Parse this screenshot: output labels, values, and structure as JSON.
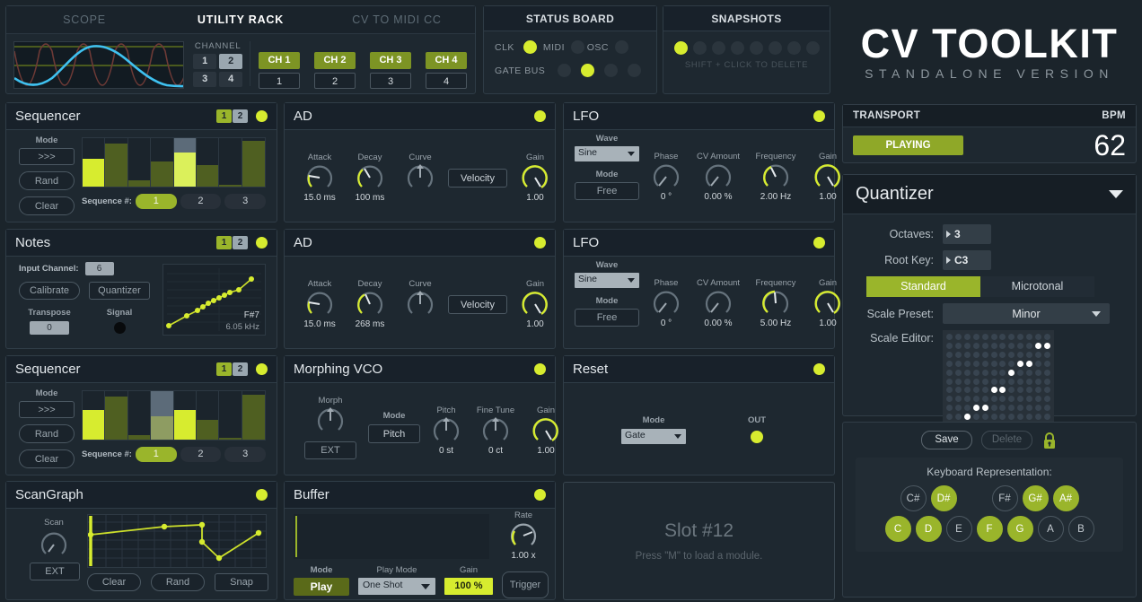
{
  "topbar": {
    "tabs": [
      {
        "label": "SCOPE",
        "active": false
      },
      {
        "label": "UTILITY RACK",
        "active": true
      },
      {
        "label": "CV TO MIDI CC",
        "active": false
      }
    ],
    "channel_label": "CHANNEL",
    "channel_buttons": [
      {
        "label": "1",
        "on": false
      },
      {
        "label": "2",
        "on": true
      },
      {
        "label": "3",
        "on": false
      },
      {
        "label": "4",
        "on": false
      }
    ],
    "utility_channels": [
      {
        "name": "CH 1",
        "value": "1"
      },
      {
        "name": "CH 2",
        "value": "2"
      },
      {
        "name": "CH 3",
        "value": "3"
      },
      {
        "name": "CH 4",
        "value": "4"
      }
    ]
  },
  "status_board": {
    "title": "STATUS BOARD",
    "row1": [
      {
        "label": "CLK",
        "on": true
      },
      {
        "label": "MIDI",
        "on": false
      },
      {
        "label": "OSC",
        "on": false
      }
    ],
    "gate_label": "GATE BUS",
    "gate_bus": [
      false,
      true,
      false,
      false
    ]
  },
  "snapshots": {
    "title": "SNAPSHOTS",
    "slots": [
      true,
      false,
      false,
      false,
      false,
      false,
      false,
      false
    ],
    "hint": "SHIFT + CLICK TO DELETE"
  },
  "brand": {
    "main": "CV TOOLKIT",
    "sub": "STANDALONE VERSION"
  },
  "transport": {
    "title": "TRANSPORT",
    "bpm_label": "BPM",
    "state": "PLAYING",
    "bpm": "62"
  },
  "quantizer": {
    "title": "Quantizer",
    "octaves_label": "Octaves:",
    "octaves_value": "3",
    "rootkey_label": "Root Key:",
    "rootkey_value": "C3",
    "mode_standard": "Standard",
    "mode_microtonal": "Microtonal",
    "mode_selected": "Standard",
    "scale_preset_label": "Scale Preset:",
    "scale_preset_value": "Minor",
    "scale_editor_label": "Scale Editor:",
    "scale_editor_on": [
      [
        1,
        10
      ],
      [
        1,
        11
      ],
      [
        3,
        8
      ],
      [
        3,
        9
      ],
      [
        4,
        7
      ],
      [
        6,
        5
      ],
      [
        6,
        6
      ],
      [
        8,
        3
      ],
      [
        8,
        4
      ],
      [
        9,
        2
      ],
      [
        11,
        0
      ],
      [
        11,
        1
      ]
    ],
    "save_label": "Save",
    "delete_label": "Delete",
    "lock_icon": "lock",
    "keyboard_title": "Keyboard Representation:",
    "black_keys": [
      {
        "label": "C#",
        "on": false
      },
      {
        "label": "D#",
        "on": true
      },
      {
        "label": "",
        "gap": true
      },
      {
        "label": "F#",
        "on": false
      },
      {
        "label": "G#",
        "on": true
      },
      {
        "label": "A#",
        "on": true
      }
    ],
    "white_keys": [
      {
        "label": "C",
        "on": true
      },
      {
        "label": "D",
        "on": true
      },
      {
        "label": "E",
        "on": false
      },
      {
        "label": "F",
        "on": true
      },
      {
        "label": "G",
        "on": true
      },
      {
        "label": "A",
        "on": false
      },
      {
        "label": "B",
        "on": false
      }
    ]
  },
  "modules": {
    "seq1": {
      "title": "Sequencer",
      "pp": [
        "1",
        "2"
      ],
      "mode_label": "Mode",
      "mode_value": ">>>",
      "rand_label": "Rand",
      "clear_label": "Clear",
      "sequence_label": "Sequence #:",
      "sequence_buttons": [
        {
          "label": "1",
          "on": true
        },
        {
          "label": "2",
          "on": false
        },
        {
          "label": "3",
          "on": false
        }
      ],
      "bars": [
        0.58,
        0.88,
        0.13,
        0.52,
        0.7,
        0.45,
        0.04,
        0.95
      ],
      "active_step": 4
    },
    "notes": {
      "title": "Notes",
      "pp": [
        "1",
        "2"
      ],
      "input_channel_label": "Input Channel:",
      "input_channel_value": "6",
      "calibrate_label": "Calibrate",
      "quantizer_label": "Quantizer",
      "transpose_label": "Transpose",
      "transpose_value": "0",
      "signal_label": "Signal",
      "note_value": "F#7",
      "freq_value": "6.05 kHz"
    },
    "seq2": {
      "title": "Sequencer",
      "pp": [
        "1",
        "2"
      ],
      "mode_label": "Mode",
      "mode_value": ">>>",
      "rand_label": "Rand",
      "clear_label": "Clear",
      "sequence_label": "Sequence #:",
      "sequence_buttons": [
        {
          "label": "1",
          "on": true
        },
        {
          "label": "2",
          "on": false
        },
        {
          "label": "3",
          "on": false
        }
      ],
      "bars": [
        0.62,
        0.88,
        0.1,
        0.48,
        0.62,
        0.4,
        0.03,
        0.92
      ],
      "active_step": 3
    },
    "scangraph": {
      "title": "ScanGraph",
      "scan_label": "Scan",
      "ext_label": "EXT",
      "clear_label": "Clear",
      "rand_label": "Rand",
      "snap_label": "Snap",
      "points": [
        [
          0,
          0.62
        ],
        [
          0.27,
          0.8
        ],
        [
          0.48,
          0.82
        ],
        [
          0.48,
          0.52
        ],
        [
          0.65,
          0.12
        ],
        [
          0.93,
          0.58
        ]
      ]
    },
    "ad1": {
      "title": "AD",
      "attack_label": "Attack",
      "attack_value": "15.0 ms",
      "attack_pos": 0.18,
      "decay_label": "Decay",
      "decay_value": "100 ms",
      "decay_pos": 0.35,
      "curve_label": "Curve",
      "curve_value": "",
      "curve_pos": 0.5,
      "velocity_label": "Velocity",
      "gain_label": "Gain",
      "gain_value": "1.00",
      "gain_pos": 0.82
    },
    "ad2": {
      "title": "AD",
      "attack_label": "Attack",
      "attack_value": "15.0 ms",
      "attack_pos": 0.18,
      "decay_label": "Decay",
      "decay_value": "268 ms",
      "decay_pos": 0.4,
      "curve_label": "Curve",
      "curve_value": "",
      "curve_pos": 0.5,
      "velocity_label": "Velocity",
      "gain_label": "Gain",
      "gain_value": "1.00",
      "gain_pos": 0.82
    },
    "vco": {
      "title": "Morphing VCO",
      "morph_label": "Morph",
      "morph_pos": 0.5,
      "ext_label": "EXT",
      "mode_label": "Mode",
      "mode_value": "Pitch",
      "pitch_label": "Pitch",
      "pitch_value": "0 st",
      "pitch_pos": 0.5,
      "finetune_label": "Fine Tune",
      "finetune_value": "0 ct",
      "finetune_pos": 0.5,
      "gain_label": "Gain",
      "gain_value": "1.00",
      "gain_pos": 0.82
    },
    "buffer": {
      "title": "Buffer",
      "rate_label": "Rate",
      "rate_value": "1.00 x",
      "rate_pos": 0.45,
      "mode_label": "Mode",
      "mode_value": "Play",
      "playmode_label": "Play Mode",
      "playmode_value": "One Shot",
      "gain_label": "Gain",
      "gain_value": "100 %",
      "trigger_label": "Trigger"
    },
    "lfo1": {
      "title": "LFO",
      "wave_label": "Wave",
      "wave_value": "Sine",
      "mode_label": "Mode",
      "mode_value": "Free",
      "phase_label": "Phase",
      "phase_value": "0 °",
      "phase_pos": 0.12,
      "cv_label": "CV Amount",
      "cv_value": "0.00 %",
      "cv_pos": 0.12,
      "freq_label": "Frequency",
      "freq_value": "2.00 Hz",
      "freq_pos": 0.4,
      "gain_label": "Gain",
      "gain_value": "1.00",
      "gain_pos": 0.82
    },
    "lfo2": {
      "title": "LFO",
      "wave_label": "Wave",
      "wave_value": "Sine",
      "mode_label": "Mode",
      "mode_value": "Free",
      "phase_label": "Phase",
      "phase_value": "0 °",
      "phase_pos": 0.12,
      "cv_label": "CV Amount",
      "cv_value": "0.00 %",
      "cv_pos": 0.12,
      "freq_label": "Frequency",
      "freq_value": "5.00 Hz",
      "freq_pos": 0.47,
      "gain_label": "Gain",
      "gain_value": "1.00",
      "gain_pos": 0.82
    },
    "reset": {
      "title": "Reset",
      "mode_label": "Mode",
      "mode_value": "Gate",
      "out_label": "OUT"
    },
    "slot": {
      "title": "Slot #12",
      "subtitle": "Press \"M\" to load a module."
    }
  },
  "colors": {
    "accent": "#d7ec2f",
    "green": "#9ab52b",
    "bg": "#1b242b",
    "panel": "#1e2830",
    "scope_line": "#3fc1f0"
  }
}
